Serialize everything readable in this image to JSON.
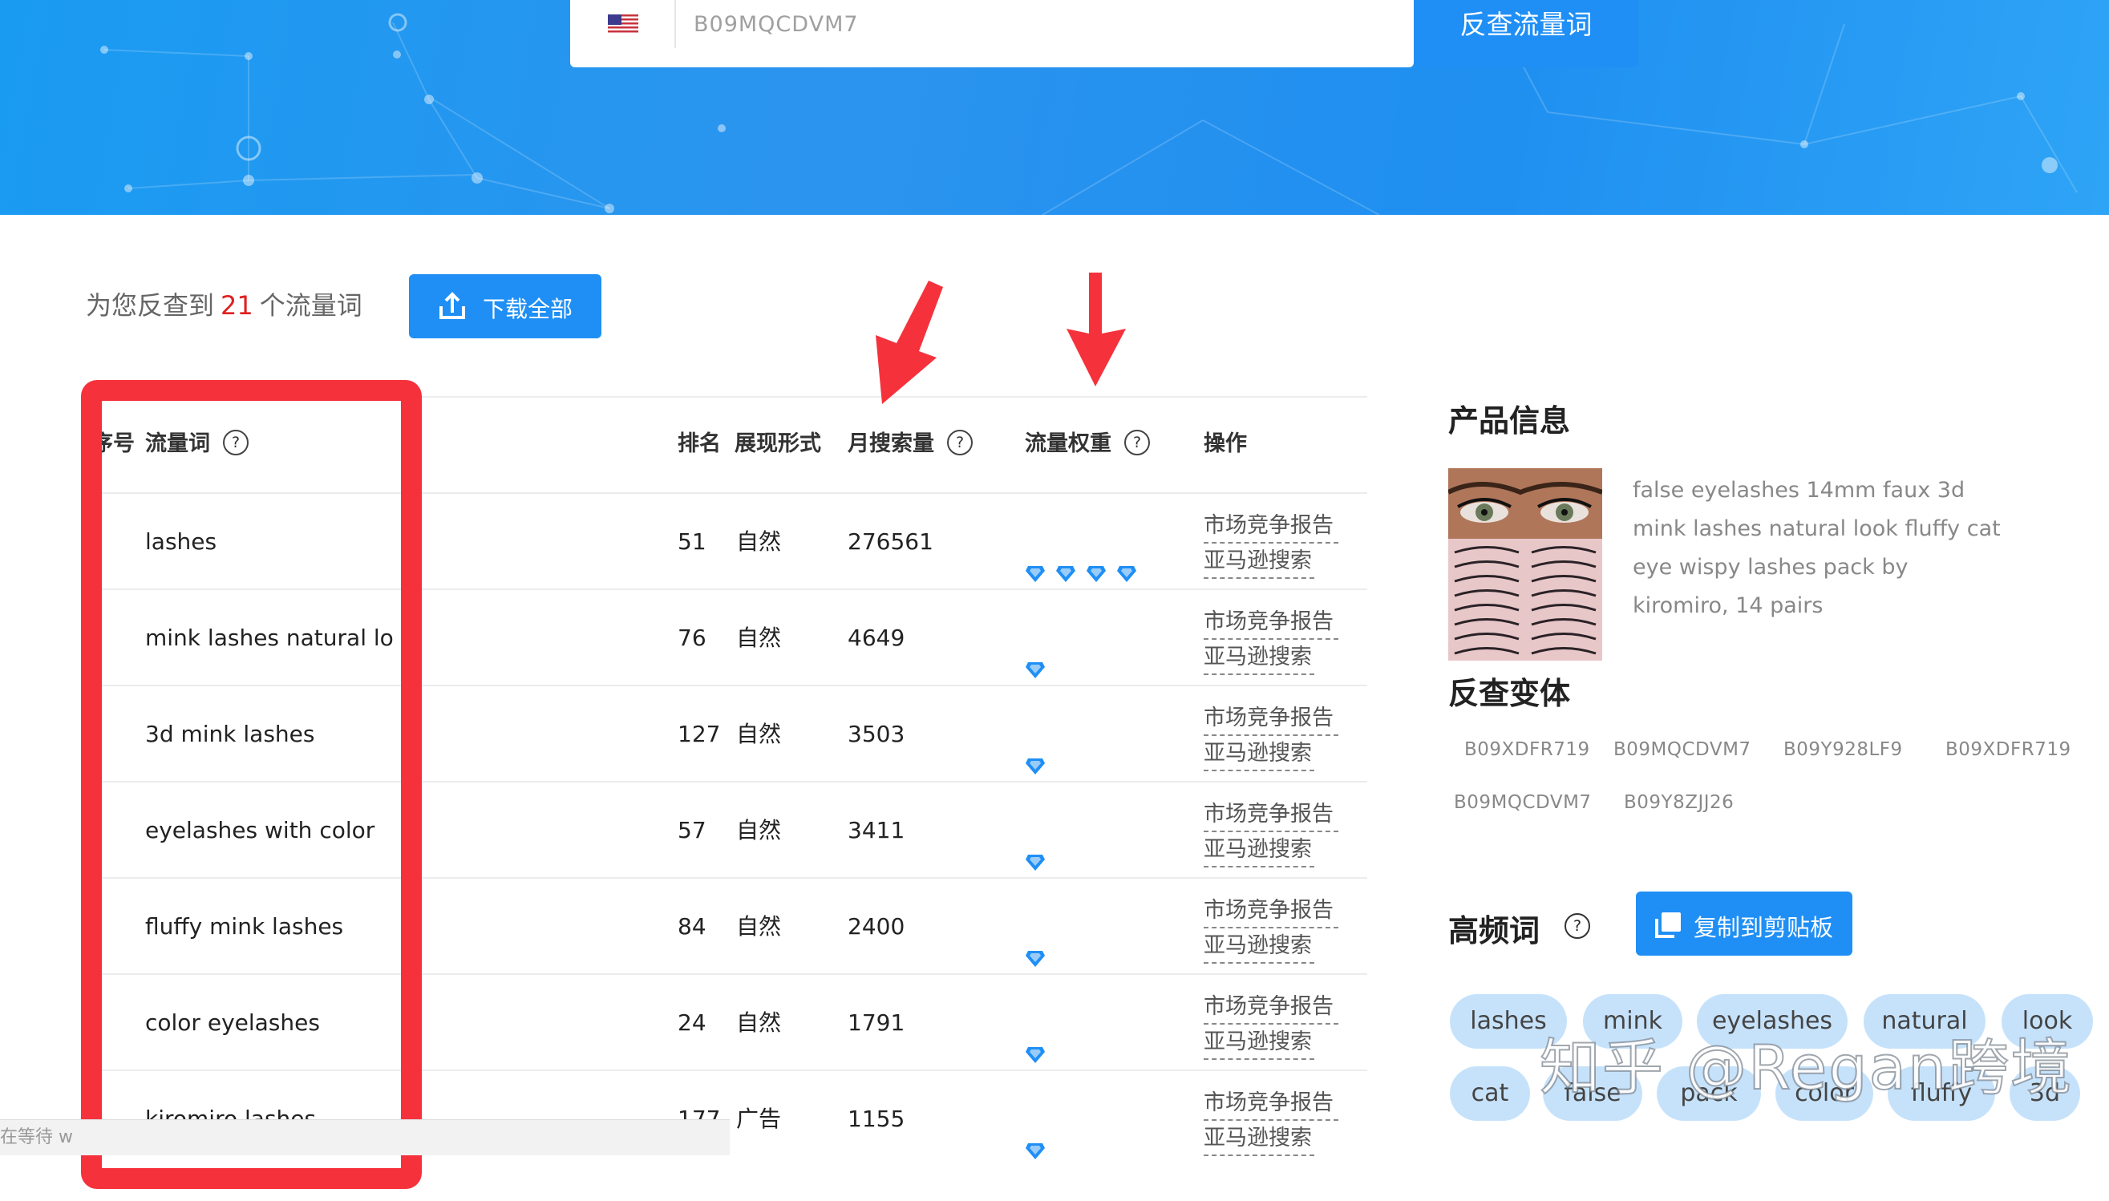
{
  "search": {
    "flag": "us-flag-icon",
    "value": "B09MQCDVM7",
    "button_label": "反查流量词"
  },
  "summary": {
    "prefix": "为您反查到",
    "count": "21",
    "suffix": "个流量词",
    "download_label": "下载全部"
  },
  "table": {
    "headers": {
      "index": "序号",
      "keyword": "流量词",
      "rank": "排名",
      "form": "展现形式",
      "volume": "月搜索量",
      "weight": "流量权重",
      "actions": "操作"
    },
    "action_labels": [
      "市场竞争报告",
      "亚马逊搜索"
    ],
    "rows": [
      {
        "keyword": "lashes",
        "rank": "51",
        "form": "自然",
        "volume": "276561",
        "weight": 4
      },
      {
        "keyword": "mink lashes natural lo",
        "rank": "76",
        "form": "自然",
        "volume": "4649",
        "weight": 1
      },
      {
        "keyword": "3d mink lashes",
        "rank": "127",
        "form": "自然",
        "volume": "3503",
        "weight": 1
      },
      {
        "keyword": "eyelashes with color",
        "rank": "57",
        "form": "自然",
        "volume": "3411",
        "weight": 1
      },
      {
        "keyword": "fluffy mink lashes",
        "rank": "84",
        "form": "自然",
        "volume": "2400",
        "weight": 1
      },
      {
        "keyword": "color eyelashes",
        "rank": "24",
        "form": "自然",
        "volume": "1791",
        "weight": 1
      },
      {
        "keyword": "kiromiro lashes",
        "rank": "177",
        "form": "广告",
        "volume": "1155",
        "weight": 1
      }
    ]
  },
  "product": {
    "title": "产品信息",
    "description": "false eyelashes 14mm faux 3d mink lashes natural look fluffy cat eye wispy lashes pack by kiromiro, 14 pairs"
  },
  "variants": {
    "title": "反查变体",
    "items": [
      "B09XDFR719",
      "B09MQCDVM7",
      "B09Y928LF9",
      "B09XDFR719",
      "B09MQCDVM7",
      "B09Y8ZJJ26"
    ]
  },
  "high_freq": {
    "title": "高频词",
    "copy_label": "复制到剪贴板",
    "tags": [
      "lashes",
      "mink",
      "eyelashes",
      "natural",
      "look",
      "cat",
      "false",
      "pack",
      "color",
      "fluffy",
      "3d"
    ]
  },
  "watermark": "知乎 @Regan跨境",
  "status_text": "在等待 w",
  "colors": {
    "accent": "#1f8ff5",
    "highlight": "#f5323c",
    "count": "#e02020",
    "tag_bg": "#c6e2fb"
  }
}
